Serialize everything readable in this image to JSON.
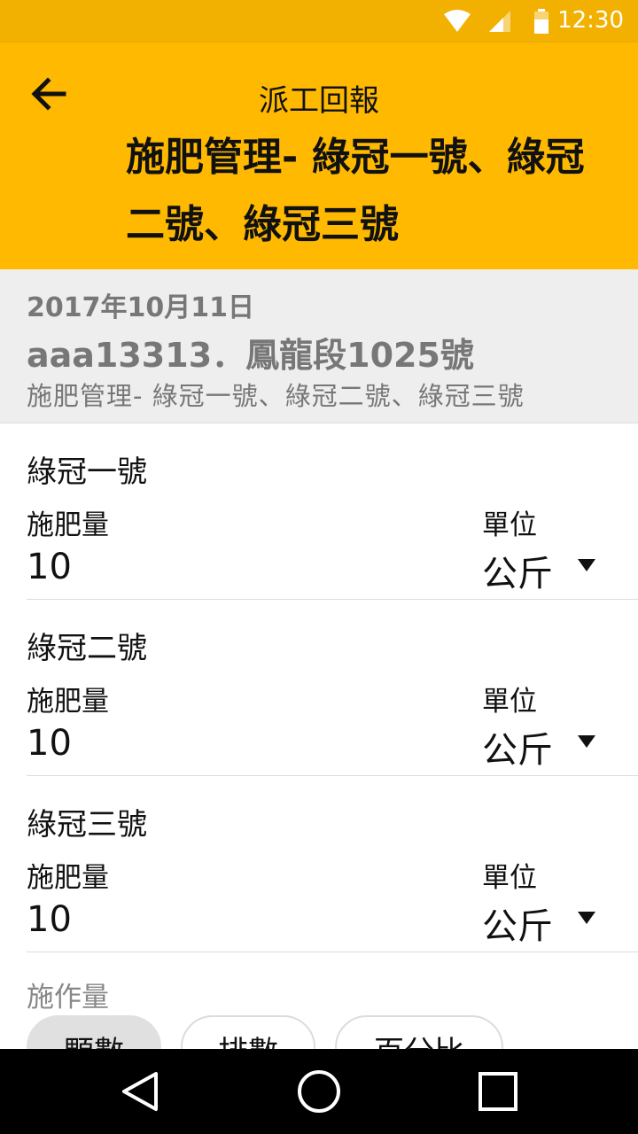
{
  "status_bar": {
    "time": "12:30",
    "icons": [
      "wifi-icon",
      "signal-icon",
      "battery-icon"
    ]
  },
  "app_bar": {
    "back_icon": "arrow-left-icon",
    "title": "派工回報",
    "subtitle": "施肥管理- 綠冠一號、綠冠二號、綠冠三號"
  },
  "info": {
    "date": "2017年10月11日",
    "plot": "aaa13313．鳳龍段1025號",
    "task": "施肥管理- 綠冠一號、綠冠二號、綠冠三號"
  },
  "entries": [
    {
      "name": "綠冠一號",
      "amount_label": "施肥量",
      "amount": "10",
      "unit_label": "單位",
      "unit": "公斤"
    },
    {
      "name": "綠冠二號",
      "amount_label": "施肥量",
      "amount": "10",
      "unit_label": "單位",
      "unit": "公斤"
    },
    {
      "name": "綠冠三號",
      "amount_label": "施肥量",
      "amount": "10",
      "unit_label": "單位",
      "unit": "公斤"
    }
  ],
  "work_amount": {
    "label": "施作量",
    "options": [
      "顆數",
      "排數",
      "百分比"
    ],
    "selected": "顆數"
  },
  "nav_bar": {
    "icons": [
      "back-triangle-icon",
      "home-circle-icon",
      "recents-square-icon"
    ]
  },
  "colors": {
    "status_bar": "#F2B100",
    "app_bar": "#FFB900",
    "info_bg": "#EEEEEE",
    "nav_bar": "#000000"
  }
}
